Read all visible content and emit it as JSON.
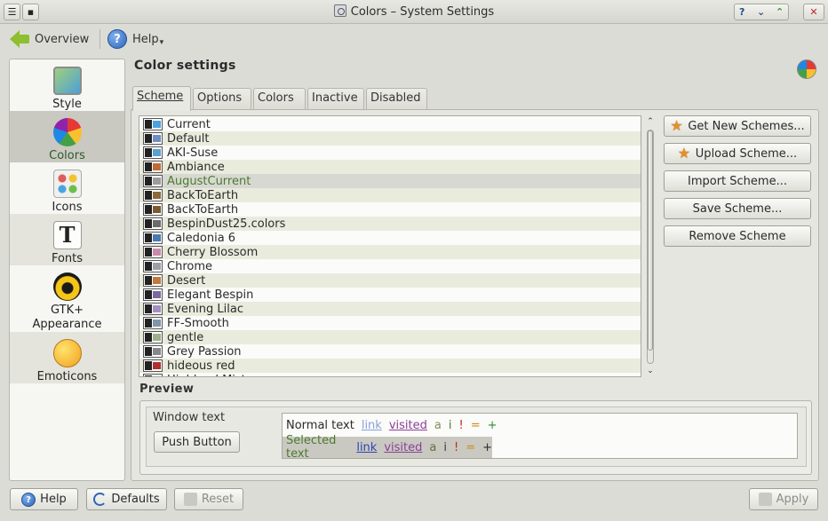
{
  "window": {
    "title": "Colors – System Settings",
    "menu_glyph": "☰",
    "pin_glyph": "▪",
    "help_glyph": "?",
    "minimize_glyph": "⌄",
    "maximize_glyph": "⌃",
    "close_glyph": "✕"
  },
  "toolbar": {
    "overview_label": "Overview",
    "help_label": "Help",
    "help_glyph": "?",
    "help_menu_glyph": "▾"
  },
  "sidebar": {
    "items": [
      {
        "label": "Style",
        "icon": "style-icon"
      },
      {
        "label": "Colors",
        "icon": "colors-icon"
      },
      {
        "label": "Icons",
        "icon": "icons-icon"
      },
      {
        "label": "Fonts",
        "icon": "fonts-icon",
        "glyph": "T"
      },
      {
        "label_line1": "GTK+",
        "label_line2": "Appearance",
        "icon": "gtk-icon"
      },
      {
        "label": "Emoticons",
        "icon": "emoticons-icon"
      }
    ]
  },
  "main": {
    "heading": "Color settings",
    "tabs": [
      "Scheme",
      "Options",
      "Colors",
      "Inactive",
      "Disabled"
    ],
    "active_tab": "Scheme"
  },
  "schemes": {
    "items": [
      "Current",
      "Default",
      "AKI-Suse",
      "Ambiance",
      "AugustCurrent",
      "BackToEarth",
      "BackToEarth",
      "BespinDust25.colors",
      "Caledonia 6",
      "Cherry Blossom",
      "Chrome",
      "Desert",
      "Elegant Bespin",
      "Evening Lilac",
      "FF-Smooth",
      "gentle",
      "Grey Passion",
      "hideous red",
      "Highland Mist"
    ],
    "selected": "AugustCurrent",
    "scroll_up_glyph": "⌃",
    "scroll_down_glyph": "⌄"
  },
  "scheme_buttons": {
    "get_new": "Get New Schemes...",
    "upload": "Upload Scheme...",
    "import": "Import Scheme...",
    "save": "Save Scheme...",
    "remove": "Remove Scheme"
  },
  "preview": {
    "label": "Preview",
    "window_text": "Window text",
    "push_button": "Push Button",
    "normal_text": "Normal text",
    "selected_text": "Selected text",
    "link": "link",
    "visited": "visited",
    "a": "a",
    "i": "i",
    "bang": "!",
    "eq": "=",
    "plus": "+"
  },
  "footer": {
    "help": "Help",
    "defaults": "Defaults",
    "reset": "Reset",
    "apply": "Apply",
    "help_glyph": "?"
  },
  "colors": {
    "selection_green": "#4b7a2f",
    "accent_orange": "#e2902a",
    "link_blue": "#4d64c8",
    "visited_purple": "#8a4096"
  }
}
